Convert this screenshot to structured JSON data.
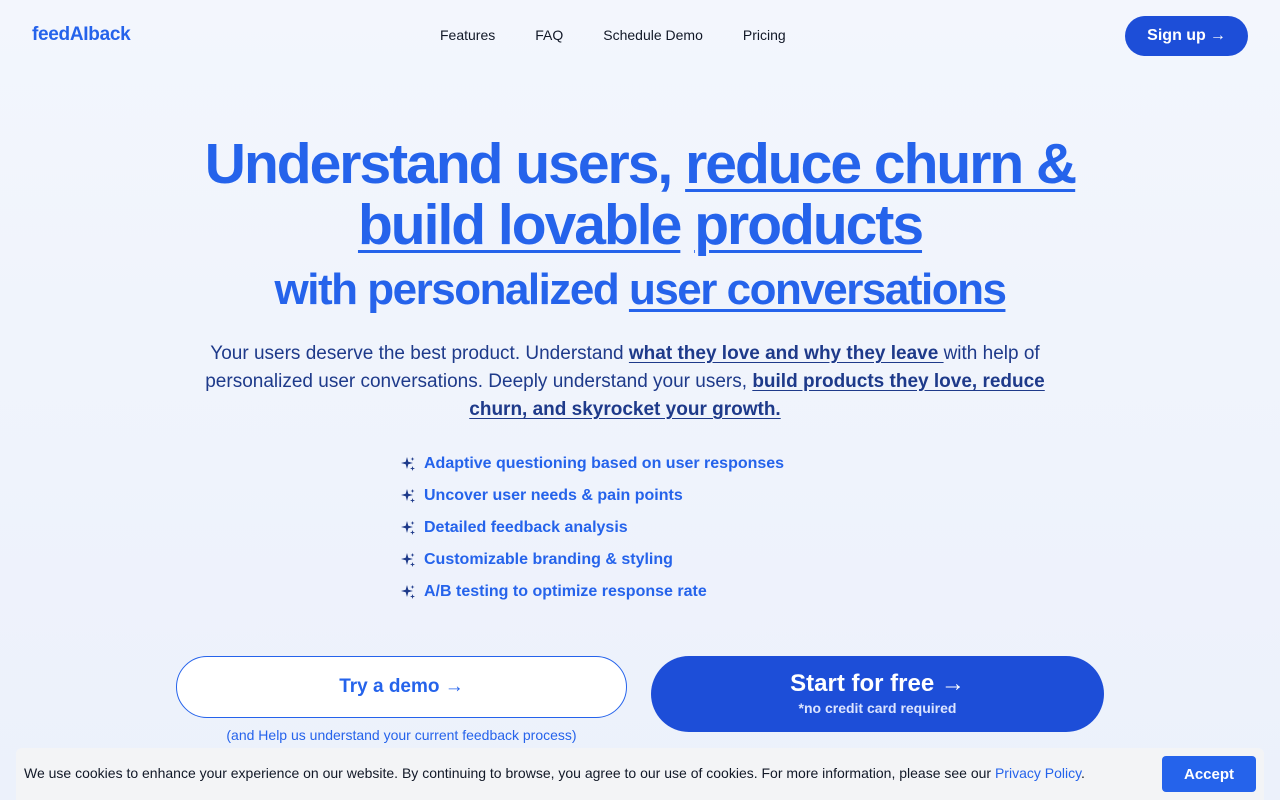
{
  "header": {
    "logo": "feedAIback",
    "nav": [
      "Features",
      "FAQ",
      "Schedule Demo",
      "Pricing"
    ],
    "signup_label": "Sign up",
    "arrow": "→"
  },
  "hero": {
    "title_plain": "Understand users, ",
    "title_underlined_1": "reduce churn &",
    "title_underlined_2": "build lovable",
    "title_underlined_3": "products",
    "subtitle_plain": "with personalized ",
    "subtitle_underlined": "user conversations"
  },
  "lede": {
    "part1": "Your users deserve the best product. Understand ",
    "bold1": "what they love and why they leave ",
    "part2": "with help of personalized user conversations. Deeply understand your users, ",
    "bold2": "build products they love, reduce churn, and skyrocket your growth."
  },
  "features": [
    "Adaptive questioning based on user responses",
    "Uncover user needs & pain points",
    "Detailed feedback analysis",
    "Customizable branding & styling",
    "A/B testing to optimize response rate"
  ],
  "cta": {
    "demo_label": "Try a demo →",
    "demo_note": "(and Help us understand your current feedback process)",
    "start_label": "Start for free →",
    "start_note": "*no credit card required"
  },
  "cookie": {
    "text": "We use cookies to enhance your experience on our website. By continuing to browse, you agree to our use of cookies. For more information, please see our ",
    "link": "Privacy Policy",
    "end": ".",
    "accept_label": "Accept"
  },
  "colors": {
    "brand": "#2563eb",
    "button": "#1d4ed8",
    "text_dark": "#1e3a8a"
  }
}
